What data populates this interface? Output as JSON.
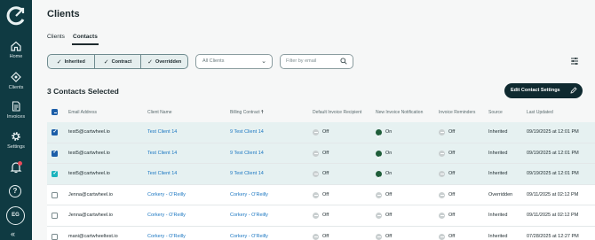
{
  "sidebar": {
    "items": [
      {
        "label": "Home",
        "icon": "home-icon"
      },
      {
        "label": "Clients",
        "icon": "clients-icon"
      },
      {
        "label": "Invoices",
        "icon": "invoices-icon"
      },
      {
        "label": "Settings",
        "icon": "gear-icon"
      }
    ],
    "help": "?",
    "avatar_initials": "EG",
    "collapse": "«"
  },
  "page": {
    "title": "Clients",
    "tabs": [
      "Clients",
      "Contacts"
    ],
    "active_tab": "Contacts"
  },
  "filters": {
    "segments": [
      "Inherited",
      "Contract",
      "Overridden"
    ],
    "client_select": "All Clients",
    "search_placeholder": "Filter by email"
  },
  "selection": {
    "title": "3 Contacts Selected",
    "edit_button": "Edit Contact Settings"
  },
  "table": {
    "headers": [
      "Email Address",
      "Client Name",
      "Billing Contract",
      "Default Invoice Recipient",
      "New Invoice Notification",
      "Invoice Reminders",
      "Source",
      "Last Updated"
    ],
    "sort_column": "Billing Contract",
    "rows": [
      {
        "selected": true,
        "checkbox_style": "blue",
        "email": "test5@cartwheel.io",
        "client": "Test Client 14",
        "contract": "9 Test Client 14",
        "default_recipient": "Off",
        "new_invoice": "On",
        "reminders": "Off",
        "source": "Inherited",
        "updated": "09/19/2025 at 12:01 PM"
      },
      {
        "selected": true,
        "checkbox_style": "blue",
        "email": "test5@cartwheel.io",
        "client": "Test Client 14",
        "contract": "9 Test Client 14",
        "default_recipient": "Off",
        "new_invoice": "On",
        "reminders": "Off",
        "source": "Inherited",
        "updated": "09/19/2025 at 12:01 PM"
      },
      {
        "selected": true,
        "checkbox_style": "teal",
        "email": "test5@cartwheel.io",
        "client": "Test Client 14",
        "contract": "9 Test Client 14",
        "default_recipient": "Off",
        "new_invoice": "On",
        "reminders": "Off",
        "source": "Inherited",
        "updated": "09/19/2025 at 12:01 PM"
      },
      {
        "selected": false,
        "checkbox_style": "none",
        "email": "Jenna@cartwheel.io",
        "client": "Corkery - O'Reilly",
        "contract": "Corkery - O'Reilly",
        "default_recipient": "Off",
        "new_invoice": "Off",
        "reminders": "Off",
        "source": "Overridden",
        "updated": "09/11/2025 at 02:12 PM"
      },
      {
        "selected": false,
        "checkbox_style": "none",
        "email": "Jenna@cartwheel.io",
        "client": "Corkery - O'Reilly",
        "contract": "Corkery - O'Reilly",
        "default_recipient": "Off",
        "new_invoice": "Off",
        "reminders": "Off",
        "source": "Inherited",
        "updated": "09/11/2025 at 02:12 PM"
      },
      {
        "selected": false,
        "checkbox_style": "none",
        "email": "mani@cartwheeltest.io",
        "client": "Corkery - O'Reilly",
        "contract": "Corkery - O'Reilly",
        "default_recipient": "Off",
        "new_invoice": "Off",
        "reminders": "Off",
        "source": "Inherited",
        "updated": "07/28/2025 at 12:27 PM"
      }
    ]
  },
  "colors": {
    "sidebar": "#0f3a42",
    "link": "#1a76c1",
    "selected_row": "#e6f1f1",
    "checkbox": "#1c5ea8",
    "button": "#0f2a30"
  }
}
